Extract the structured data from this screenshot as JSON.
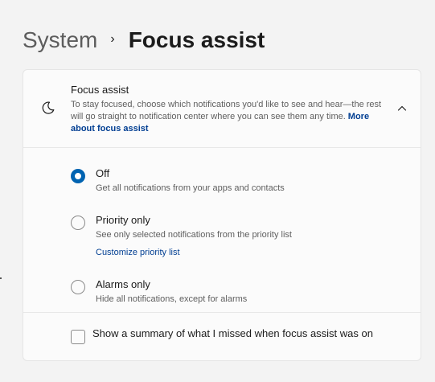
{
  "breadcrumb": {
    "parent": "System",
    "separator": "›",
    "current": "Focus assist"
  },
  "focus_assist": {
    "title": "Focus assist",
    "description": "To stay focused, choose which notifications you'd like to see and hear—the rest will go straight to notification center where you can see them any time.",
    "link": "More about focus assist",
    "icon": "moon-icon",
    "expanded": true,
    "options": [
      {
        "label": "Off",
        "description": "Get all notifications from your apps and contacts",
        "selected": true
      },
      {
        "label": "Priority only",
        "description": "See only selected notifications from the priority list",
        "link": "Customize priority list",
        "selected": false
      },
      {
        "label": "Alarms only",
        "description": "Hide all notifications, except for alarms",
        "selected": false
      }
    ],
    "summary_checkbox": {
      "label": "Show a summary of what I missed when focus assist was on",
      "checked": false
    }
  },
  "colors": {
    "accent": "#0063b1",
    "link": "#003e92",
    "background": "#f3f3f3",
    "card": "#fbfbfb"
  }
}
